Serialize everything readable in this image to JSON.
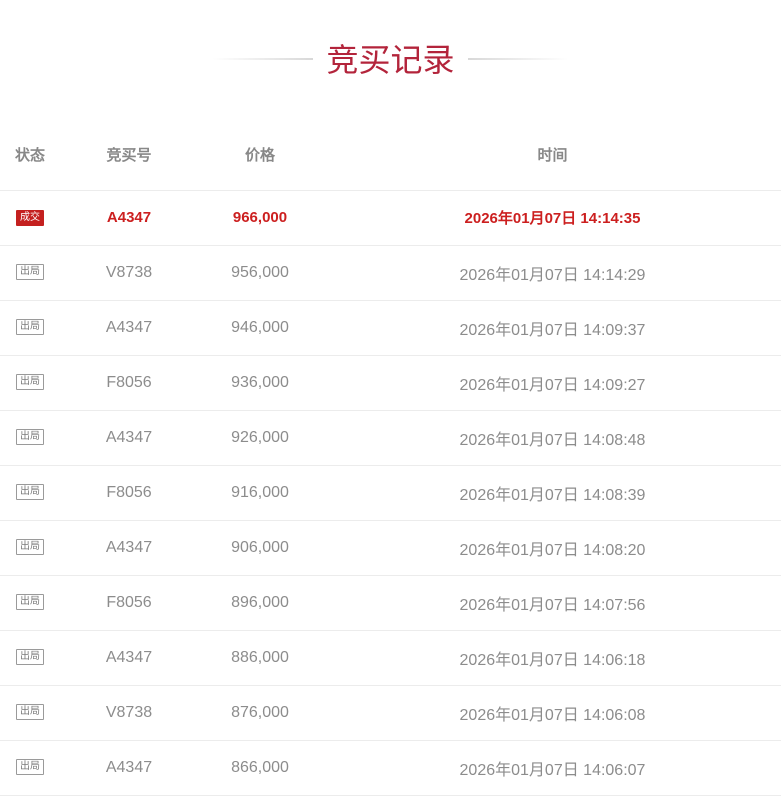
{
  "title": "竞买记录",
  "colors": {
    "title": "#b3243b",
    "deal": "#cc1f1f",
    "text": "#8c8c8c",
    "border": "#ececec"
  },
  "headers": {
    "status": "状态",
    "number": "竞买号",
    "price": "价格",
    "time": "时间"
  },
  "rows": [
    {
      "status": "成交",
      "number": "A4347",
      "price": "966,000",
      "time": "2026年01月07日 14:14:35",
      "deal": true
    },
    {
      "status": "出局",
      "number": "V8738",
      "price": "956,000",
      "time": "2026年01月07日 14:14:29",
      "deal": false
    },
    {
      "status": "出局",
      "number": "A4347",
      "price": "946,000",
      "time": "2026年01月07日 14:09:37",
      "deal": false
    },
    {
      "status": "出局",
      "number": "F8056",
      "price": "936,000",
      "time": "2026年01月07日 14:09:27",
      "deal": false
    },
    {
      "status": "出局",
      "number": "A4347",
      "price": "926,000",
      "time": "2026年01月07日 14:08:48",
      "deal": false
    },
    {
      "status": "出局",
      "number": "F8056",
      "price": "916,000",
      "time": "2026年01月07日 14:08:39",
      "deal": false
    },
    {
      "status": "出局",
      "number": "A4347",
      "price": "906,000",
      "time": "2026年01月07日 14:08:20",
      "deal": false
    },
    {
      "status": "出局",
      "number": "F8056",
      "price": "896,000",
      "time": "2026年01月07日 14:07:56",
      "deal": false
    },
    {
      "status": "出局",
      "number": "A4347",
      "price": "886,000",
      "time": "2026年01月07日 14:06:18",
      "deal": false
    },
    {
      "status": "出局",
      "number": "V8738",
      "price": "876,000",
      "time": "2026年01月07日 14:06:08",
      "deal": false
    },
    {
      "status": "出局",
      "number": "A4347",
      "price": "866,000",
      "time": "2026年01月07日 14:06:07",
      "deal": false
    }
  ]
}
